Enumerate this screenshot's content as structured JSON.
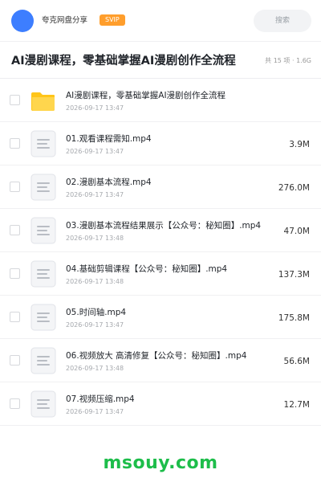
{
  "header": {
    "app_name": "夸克网盘分享",
    "badge": "SVIP",
    "search_placeholder": "搜索"
  },
  "folder": {
    "title": "AI漫剧课程，零基础掌握AI漫剧创作全流程",
    "meta": "共 15 项 · 1.6G"
  },
  "files": [
    {
      "name": "AI漫剧课程，零基础掌握AI漫剧创作全流程",
      "date": "2026-09-17 13:47",
      "size": "",
      "icon": "folder-icon"
    },
    {
      "name": "01.观看课程需知.mp4",
      "date": "2026-09-17 13:47",
      "size": "3.9M",
      "icon": "video-file-icon"
    },
    {
      "name": "02.漫剧基本流程.mp4",
      "date": "2026-09-17 13:47",
      "size": "276.0M",
      "icon": "video-file-icon"
    },
    {
      "name": "03.漫剧基本流程结果展示【公众号：秘知圈】.mp4",
      "date": "2026-09-17 13:48",
      "size": "47.0M",
      "icon": "video-file-icon"
    },
    {
      "name": "04.基础剪辑课程【公众号：秘知圈】.mp4",
      "date": "2026-09-17 13:48",
      "size": "137.3M",
      "icon": "video-file-icon"
    },
    {
      "name": "05.时间轴.mp4",
      "date": "2026-09-17 13:47",
      "size": "175.8M",
      "icon": "video-file-icon"
    },
    {
      "name": "06.视频放大 高清修复【公众号：秘知圈】.mp4",
      "date": "2026-09-17 13:48",
      "size": "56.6M",
      "icon": "video-file-icon"
    },
    {
      "name": "07.视频压缩.mp4",
      "date": "2026-09-17 13:47",
      "size": "12.7M",
      "icon": "video-file-icon"
    }
  ],
  "watermark": "msouy.com",
  "colors": {
    "avatar": "#3d7eff",
    "badge": "#ff9e2c",
    "folder": "#ffc519",
    "watermark": "#1dbd4a"
  }
}
